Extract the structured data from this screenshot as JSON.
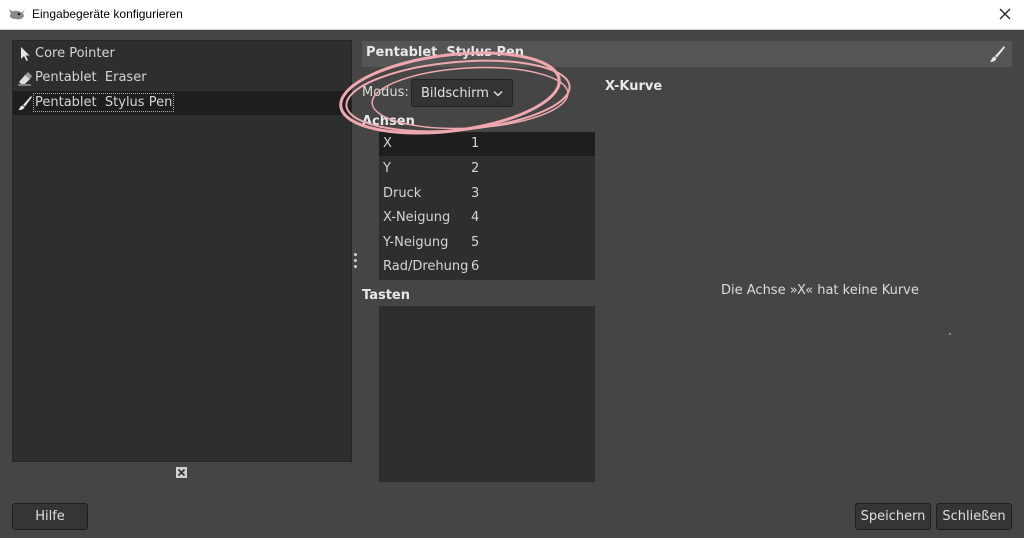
{
  "window": {
    "title": "Eingabegeräte konfigurieren",
    "app_icon": "gimp-icon",
    "close_icon": "close-icon"
  },
  "devices": [
    {
      "label": "Core Pointer",
      "icon": "arrow-pointer-icon",
      "selected": false
    },
    {
      "label": "Pentablet  Eraser",
      "icon": "eraser-icon",
      "selected": false
    },
    {
      "label": "Pentablet  Stylus Pen",
      "icon": "brush-icon",
      "selected": true
    }
  ],
  "device_panel": {
    "header": "Pentablet  Stylus Pen",
    "header_icon": "brush-icon",
    "mode_label": "Modus:",
    "mode_value": "Bildschirm",
    "axes_title": "Achsen",
    "axes": [
      {
        "name": "X",
        "index": "1"
      },
      {
        "name": "Y",
        "index": "2"
      },
      {
        "name": "Druck",
        "index": "3"
      },
      {
        "name": "X-Neigung",
        "index": "4"
      },
      {
        "name": "Y-Neigung",
        "index": "5"
      },
      {
        "name": "Rad/Drehung",
        "index": "6"
      }
    ],
    "selected_axis": "X",
    "keys_title": "Tasten"
  },
  "curve": {
    "title": "X-Kurve",
    "message": "Die Achse »X« hat keine Kurve"
  },
  "buttons": {
    "help": "Hilfe",
    "save": "Speichern",
    "close": "Schließen"
  },
  "colors": {
    "background": "#454545",
    "list_background": "#2e2e2e",
    "selection": "#1e1e1e",
    "annotation_pink": "#f0a8b0"
  }
}
